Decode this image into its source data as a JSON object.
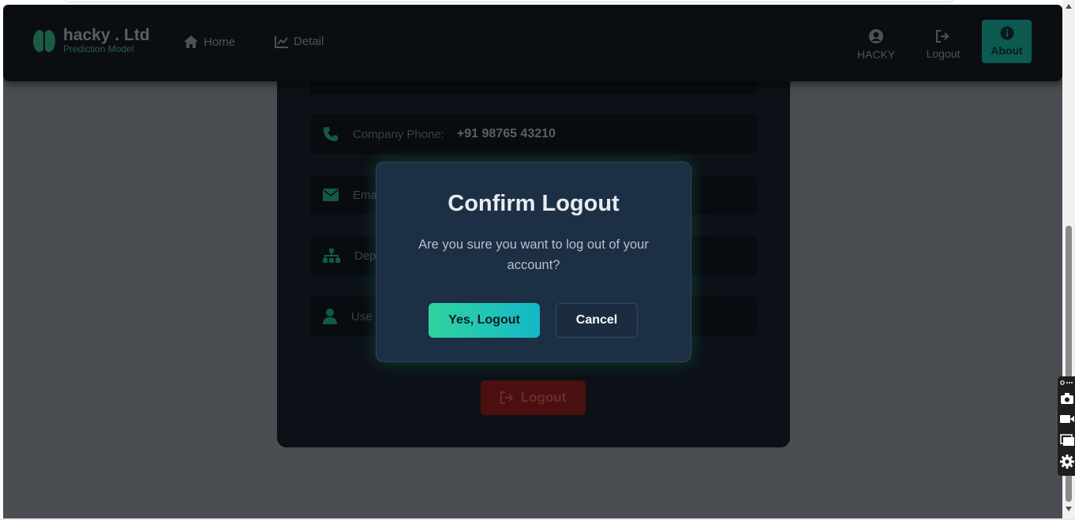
{
  "navbar": {
    "brand_title": "hacky . Ltd",
    "brand_subtitle": "Prediction Model",
    "links": [
      {
        "label": "Home",
        "icon": "home-icon"
      },
      {
        "label": "Detail",
        "icon": "chart-line-icon"
      }
    ],
    "user_label": "HACKY",
    "logout_label": "Logout",
    "about_label": "About"
  },
  "card": {
    "fields": [
      {
        "label": "Company Phone:",
        "value": "+91 98765 43210",
        "icon": "phone-icon"
      },
      {
        "label": "Ema",
        "value": "",
        "icon": "envelope-icon"
      },
      {
        "label": "Dep",
        "value": "",
        "icon": "sitemap-icon"
      },
      {
        "label": "Use",
        "value": "",
        "icon": "user-icon"
      }
    ],
    "logout_button": "Logout"
  },
  "modal": {
    "title": "Confirm Logout",
    "message": "Are you sure you want to log out of your account?",
    "confirm_label": "Yes, Logout",
    "cancel_label": "Cancel"
  },
  "colors": {
    "accent": "#2fd3a0",
    "accent_end": "#14b8c8",
    "modal_bg": "#1c2f45",
    "danger": "#4a1010"
  }
}
